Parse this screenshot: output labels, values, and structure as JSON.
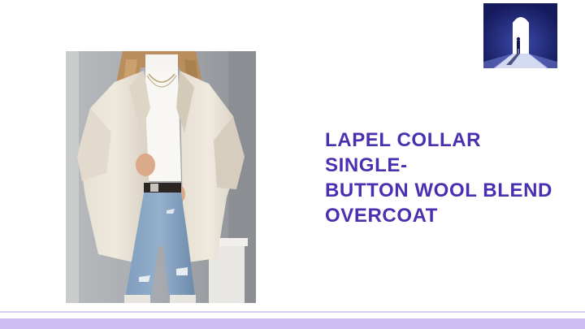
{
  "slide": {
    "title_lines": [
      "LAPEL COLLAR SINGLE-",
      "BUTTON WOOL BLEND",
      "OVERCOAT"
    ]
  },
  "product_image": {
    "subject": "woman wearing beige lapel collar wool blend overcoat with white top and ripped blue jeans"
  },
  "logo": {
    "icon": "doorway-silhouette-logo"
  },
  "colors": {
    "title": "#4a2fb0",
    "footer_band": "#cbbdf3",
    "footer_line": "#d9cff6",
    "logo_bg": "#1f2470"
  }
}
